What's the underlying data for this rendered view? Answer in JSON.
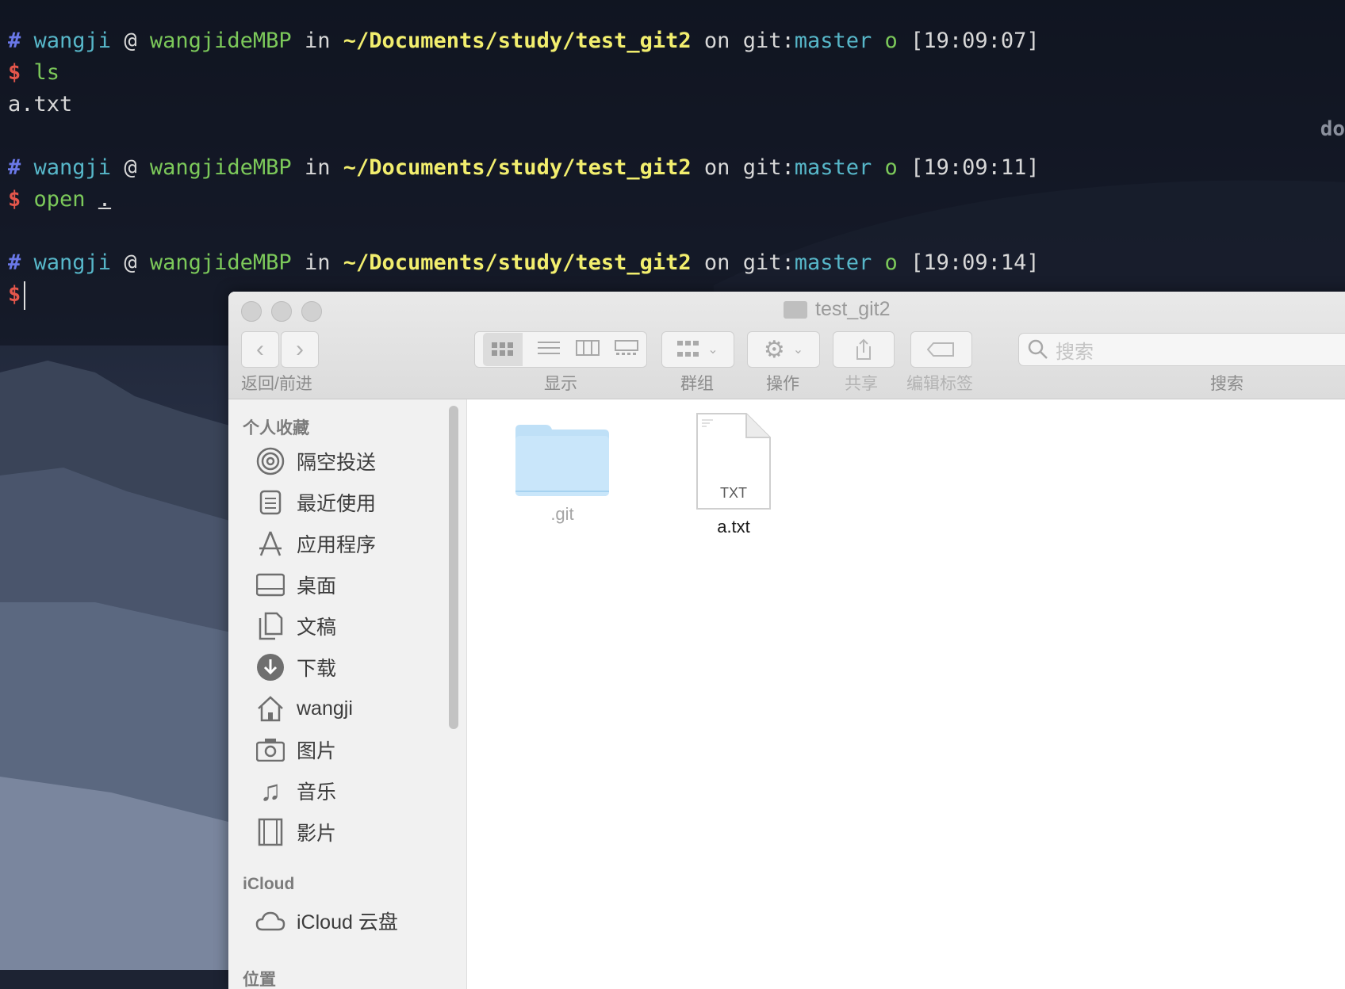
{
  "terminal": {
    "prompts": [
      {
        "hash": "#",
        "user": "wangji",
        "at": "@",
        "host": "wangjideMBP",
        "in": "in",
        "dir": "~/Documents/study/test_git2",
        "on": "on",
        "git": "git:",
        "branch": "master",
        "dirty": "o",
        "time": "[19:09:07]",
        "dollar": "$",
        "cmd": "ls",
        "arg": ""
      },
      {
        "hash": "#",
        "user": "wangji",
        "at": "@",
        "host": "wangjideMBP",
        "in": "in",
        "dir": "~/Documents/study/test_git2",
        "on": "on",
        "git": "git:",
        "branch": "master",
        "dirty": "o",
        "time": "[19:09:11]",
        "dollar": "$",
        "cmd": "open",
        "arg": "."
      },
      {
        "hash": "#",
        "user": "wangji",
        "at": "@",
        "host": "wangjideMBP",
        "in": "in",
        "dir": "~/Documents/study/test_git2",
        "on": "on",
        "git": "git:",
        "branch": "master",
        "dirty": "o",
        "time": "[19:09:14]",
        "dollar": "$",
        "cmd": "",
        "arg": ""
      }
    ],
    "output_ls": "a.txt",
    "edge_text": "do"
  },
  "finder": {
    "title": "test_git2",
    "toolbar": {
      "back_forward": "返回/前进",
      "view": "显示",
      "group": "群组",
      "action": "操作",
      "share": "共享",
      "edit_tags": "编辑标签",
      "search_label": "搜索",
      "search_placeholder": "搜索"
    },
    "sidebar": {
      "favorites_header": "个人收藏",
      "favorites": [
        {
          "label": "隔空投送",
          "icon": "airdrop-icon"
        },
        {
          "label": "最近使用",
          "icon": "recents-icon"
        },
        {
          "label": "应用程序",
          "icon": "applications-icon"
        },
        {
          "label": "桌面",
          "icon": "desktop-icon"
        },
        {
          "label": "文稿",
          "icon": "documents-icon"
        },
        {
          "label": "下载",
          "icon": "downloads-icon"
        },
        {
          "label": "wangji",
          "icon": "home-icon"
        },
        {
          "label": "图片",
          "icon": "pictures-icon"
        },
        {
          "label": "音乐",
          "icon": "music-icon"
        },
        {
          "label": "影片",
          "icon": "movies-icon"
        }
      ],
      "icloud_header": "iCloud",
      "icloud_items": [
        {
          "label": "iCloud 云盘",
          "icon": "cloud-icon"
        }
      ],
      "locations_header": "位置"
    },
    "files": [
      {
        "name": ".git",
        "type": "folder",
        "dimmed": true
      },
      {
        "name": "a.txt",
        "type": "txt",
        "badge": "TXT",
        "dimmed": false
      }
    ]
  }
}
